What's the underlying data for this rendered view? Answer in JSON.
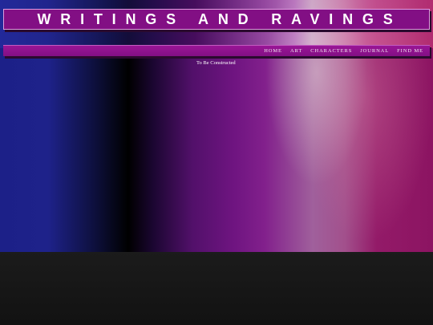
{
  "header": {
    "title": "WRITINGS AND RAVINGS"
  },
  "nav": {
    "items": [
      {
        "label": "HOME"
      },
      {
        "label": "ART"
      },
      {
        "label": "CHARACTERS"
      },
      {
        "label": "JOURNAL"
      },
      {
        "label": "FIND ME"
      }
    ]
  },
  "main": {
    "text": "To Be Constructed"
  },
  "colors": {
    "bar": "#820f84",
    "bar_border": "#dd9cdd",
    "text": "#ffffff"
  }
}
